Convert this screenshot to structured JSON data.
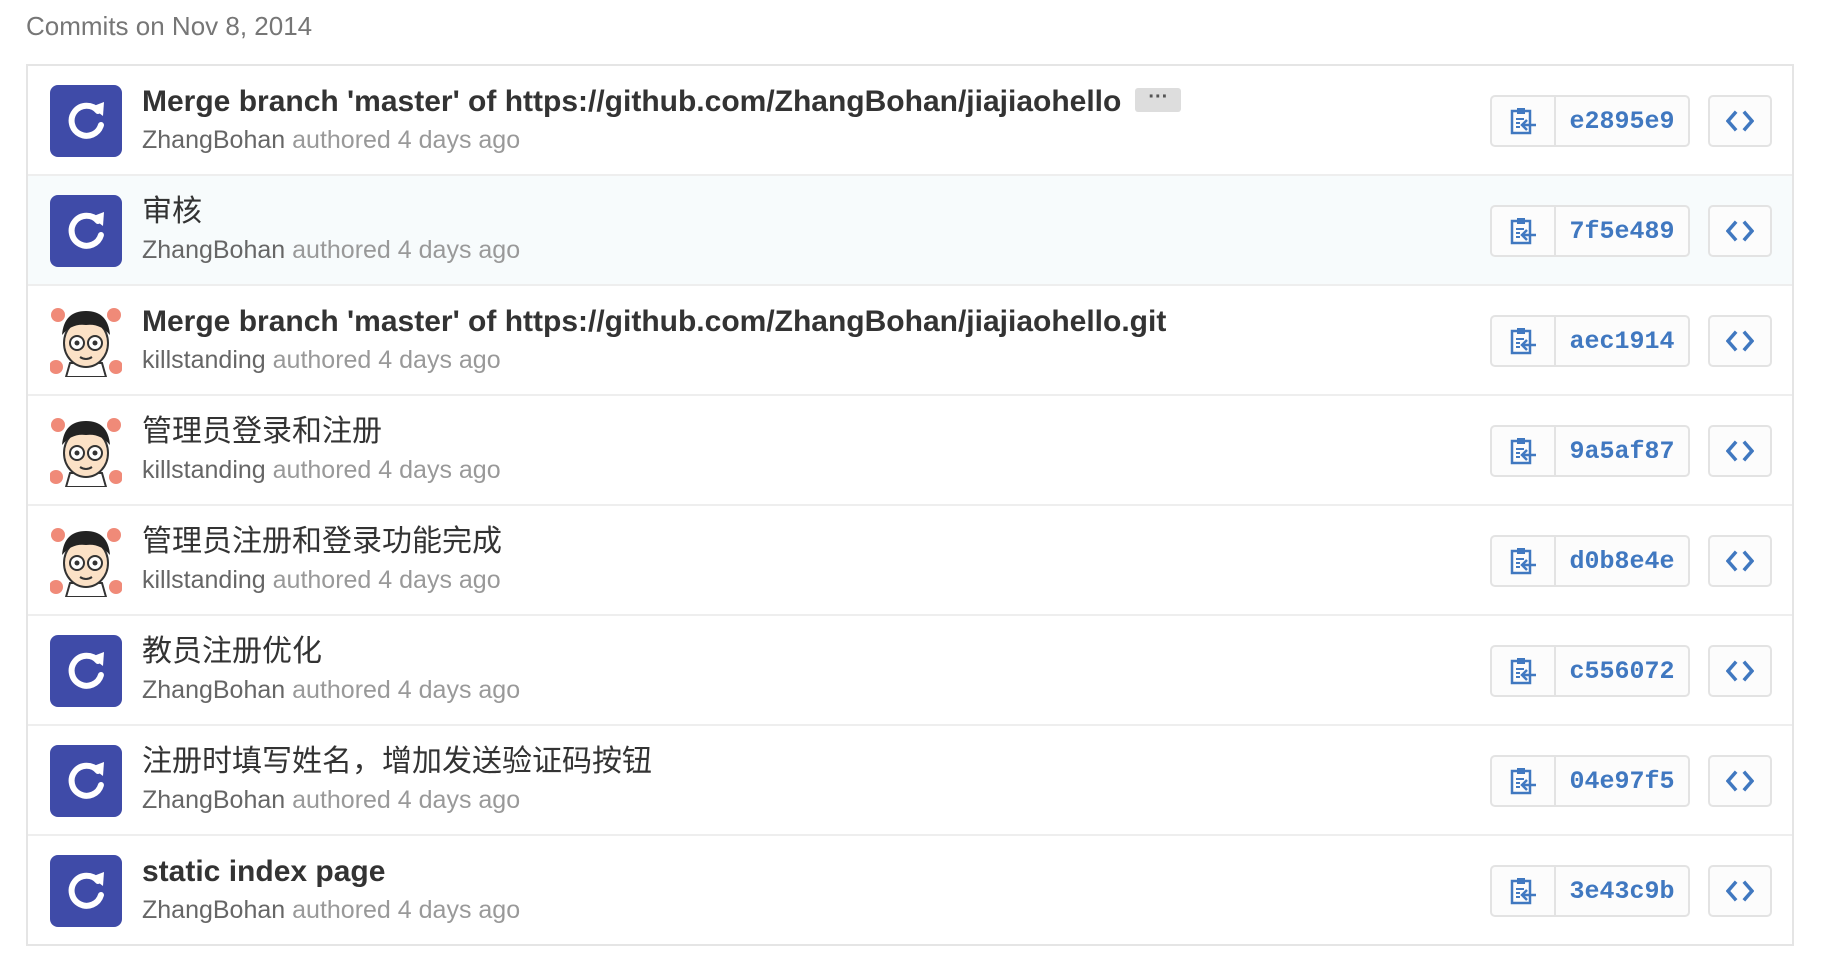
{
  "heading": "Commits on Nov 8, 2014",
  "meta_word": "authored",
  "colors": {
    "accent": "#4078c0",
    "bot_avatar": "#3f4ba8"
  },
  "commits": [
    {
      "message": "Merge branch 'master' of https://github.com/ZhangBohan/jiajiaohello",
      "has_ellipsis": true,
      "ellipsis": "···",
      "author": "ZhangBohan",
      "time": "4 days ago",
      "sha": "e2895e9",
      "avatar": "bot-avatar-icon"
    },
    {
      "message": "审核",
      "author": "ZhangBohan",
      "time": "4 days ago",
      "sha": "7f5e489",
      "avatar": "bot-avatar-icon"
    },
    {
      "message": "Merge branch 'master' of https://github.com/ZhangBohan/jiajiaohello.git",
      "author": "killstanding",
      "time": "4 days ago",
      "sha": "aec1914",
      "avatar": "cartoon-face-avatar-icon"
    },
    {
      "message": "管理员登录和注册",
      "author": "killstanding",
      "time": "4 days ago",
      "sha": "9a5af87",
      "avatar": "cartoon-face-avatar-icon"
    },
    {
      "message": "管理员注册和登录功能完成",
      "author": "killstanding",
      "time": "4 days ago",
      "sha": "d0b8e4e",
      "avatar": "cartoon-face-avatar-icon"
    },
    {
      "message": "教员注册优化",
      "author": "ZhangBohan",
      "time": "4 days ago",
      "sha": "c556072",
      "avatar": "bot-avatar-icon"
    },
    {
      "message": "注册时填写姓名，增加发送验证码按钮",
      "author": "ZhangBohan",
      "time": "4 days ago",
      "sha": "04e97f5",
      "avatar": "bot-avatar-icon"
    },
    {
      "message": "static index page",
      "author": "ZhangBohan",
      "time": "4 days ago",
      "sha": "3e43c9b",
      "avatar": "bot-avatar-icon"
    }
  ]
}
